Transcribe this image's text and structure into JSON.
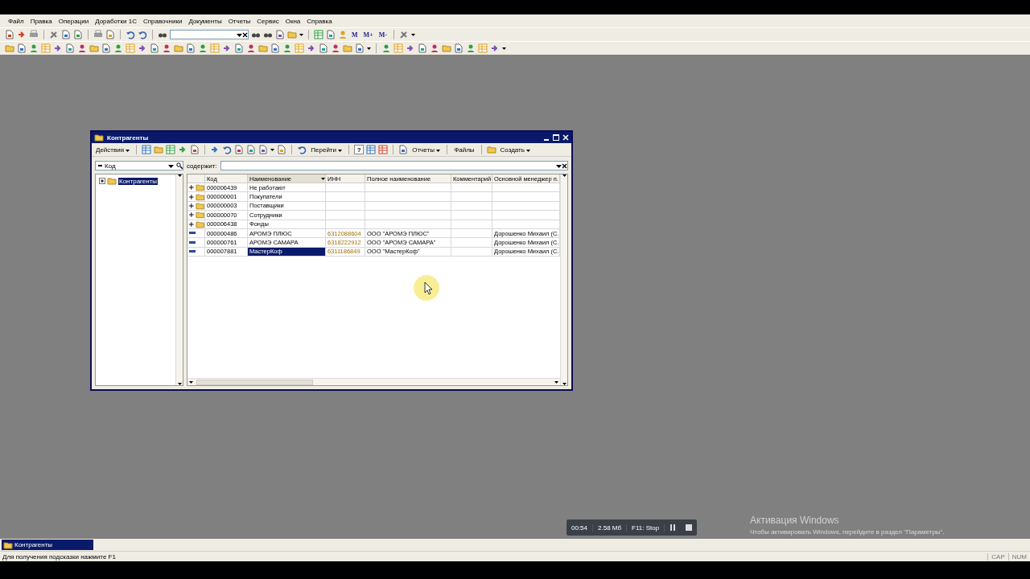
{
  "menu": [
    "Файл",
    "Правка",
    "Операции",
    "Доработки 1С",
    "Справочники",
    "Документы",
    "Отчеты",
    "Сервис",
    "Окна",
    "Справка"
  ],
  "memory_buttons": [
    "M",
    "M+",
    "M-"
  ],
  "window": {
    "title": "Контрагенты",
    "toolbar": {
      "actions_menu": "Действия",
      "goto_menu": "Перейти",
      "help_button": "?",
      "reports_menu": "Отчеты",
      "files_button": "Файлы",
      "create_menu": "Создать"
    },
    "filter": {
      "field": "Код",
      "contains_label": "содержит:"
    },
    "tree": [
      {
        "label": "Контрагенты",
        "selected": true,
        "expanded": false
      }
    ],
    "table": {
      "columns": [
        {
          "label": "Код",
          "sorted": false
        },
        {
          "label": "Наименование",
          "sorted": true
        },
        {
          "label": "ИНН",
          "sorted": false
        },
        {
          "label": "Полное наименование",
          "sorted": false
        },
        {
          "label": "Комментарий",
          "sorted": false
        },
        {
          "label": "Основной менеджер п.",
          "sorted": false
        }
      ],
      "rows": [
        {
          "kind": "group",
          "code": "000006439",
          "name": "Не работают",
          "selected": false
        },
        {
          "kind": "group",
          "code": "000000001",
          "name": "Покупатели",
          "selected": false
        },
        {
          "kind": "group",
          "code": "000000003",
          "name": "Поставщики",
          "selected": false
        },
        {
          "kind": "group",
          "code": "000000070",
          "name": "Сотрудники",
          "selected": false
        },
        {
          "kind": "group",
          "code": "000006438",
          "name": "Фонды",
          "selected": false
        },
        {
          "kind": "item",
          "code": "000000486",
          "name": "АРОМЭ ПЛЮС",
          "inn": "6312088604",
          "full_name": "ООО \"АРОМЭ ПЛЮС\"",
          "manager": "Дорошенко Михаил (С.",
          "selected": false
        },
        {
          "kind": "item",
          "code": "000000761",
          "name": "АРОМЭ САМАРА",
          "inn": "6318222912",
          "full_name": "ООО \"АРОМЭ САМАРА\"",
          "manager": "Дорошенко Михаил (С.",
          "selected": false
        },
        {
          "kind": "item",
          "code": "000007881",
          "name": "МастерКоф",
          "inn": "6311186849",
          "full_name": "ООО \"МастерКоф\"",
          "manager": "Дорошенко Михаил (С.",
          "selected": true
        }
      ]
    }
  },
  "taskbar": [
    {
      "label": "Контрагенты",
      "selected": true
    }
  ],
  "status_bar": {
    "hint": "Для получения подсказки нажмите F1",
    "indicators": [
      "CAP",
      "NUM"
    ]
  },
  "recorder": {
    "time": "00:54",
    "size": "2.58 Мб",
    "stop": "F11: Stop"
  },
  "activation": {
    "title": "Активация Windows",
    "text": "Чтобы активировать Windows, перейдите в раздел \"Параметры\"."
  }
}
